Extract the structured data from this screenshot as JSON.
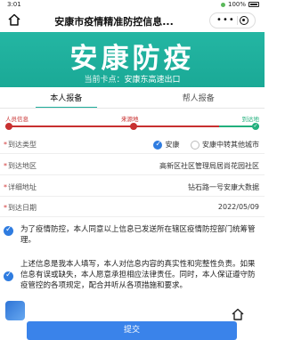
{
  "status_bar": {
    "time": "3:01",
    "battery": "100%"
  },
  "nav": {
    "title": "安康市疫情精准防控信息...",
    "more_label": "•••"
  },
  "banner": {
    "title": "安康防疫",
    "checkpoint_label": "当前卡点：",
    "checkpoint_value": "安康东高速出口"
  },
  "tabs": [
    {
      "label": "本人报备",
      "active": true
    },
    {
      "label": "帮人报备",
      "active": false
    }
  ],
  "progress": {
    "steps": [
      {
        "label": "人员信息",
        "state": "current"
      },
      {
        "label": "来源地",
        "state": "current"
      },
      {
        "label": "到达地",
        "state": "done"
      }
    ],
    "colors": {
      "active": "#c83030",
      "done": "#22b07d"
    }
  },
  "form": {
    "arrival_type": {
      "label": "到达类型",
      "options": [
        {
          "label": "安康",
          "selected": true
        },
        {
          "label": "安康中转其他城市",
          "selected": false
        }
      ]
    },
    "arrival_area": {
      "label": "到达地区",
      "value": "高新区社区管理局居尚花园社区"
    },
    "address": {
      "label": "详细地址",
      "value": "钻石路一号安康大数据"
    },
    "arrival_date": {
      "label": "到达日期",
      "value": "2022/05/09"
    }
  },
  "agreements": [
    {
      "text": "为了疫情防控，本人同意以上信息已发送所在辖区疫情防控部门统筹管理。",
      "checked": true
    },
    {
      "text": "上述信息是我本人填写，本人对信息内容的真实性和完整性负责。如果信息有误或缺失，本人愿意承担相应法律责任。同时，本人保证遵守防疫管控的各项规定，配合并听从各项措施和要求。",
      "checked": true
    }
  ],
  "submit_label": "提交",
  "colors": {
    "accent": "#1fae9c",
    "primary": "#3a83ea",
    "required": "#d23a3a"
  }
}
